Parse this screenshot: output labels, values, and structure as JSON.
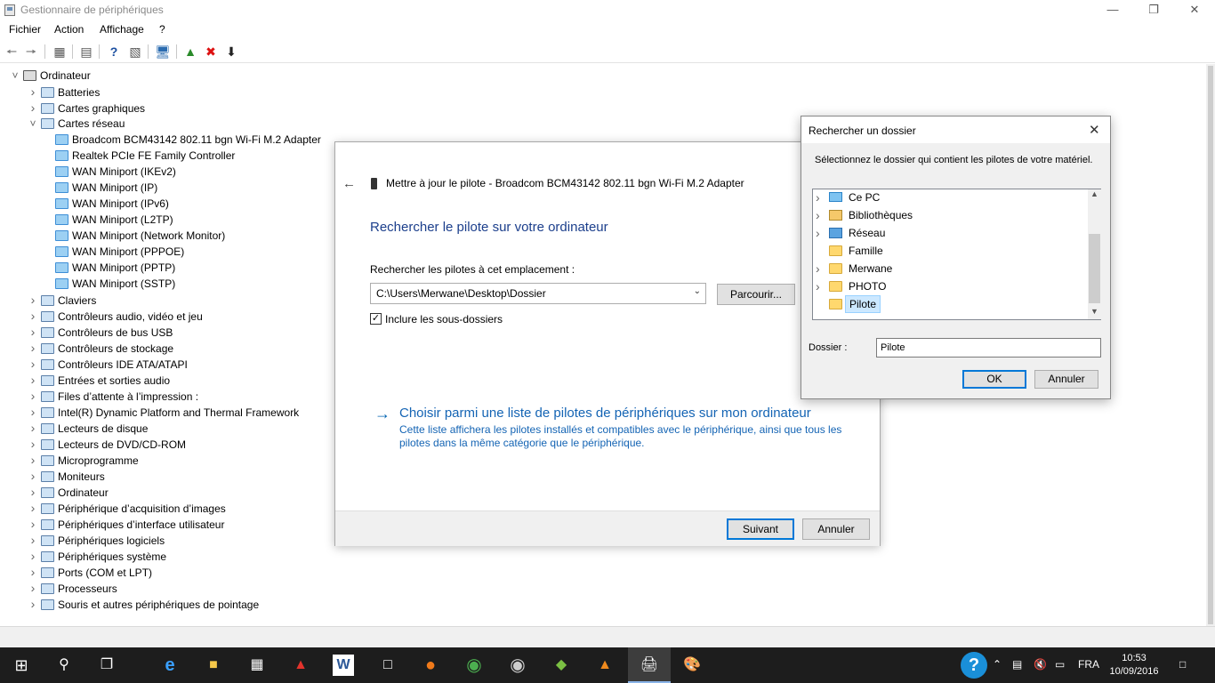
{
  "window": {
    "title": "Gestionnaire de périphériques"
  },
  "menu": [
    "Fichier",
    "Action",
    "Affichage",
    "?"
  ],
  "tree": [
    {
      "label": "Ordinateur",
      "level": 0,
      "expanded": true,
      "icon": "computer-icon"
    },
    {
      "label": "Batteries",
      "level": 1,
      "icon": "battery-icon"
    },
    {
      "label": "Cartes graphiques",
      "level": 1,
      "icon": "display-adapter-icon"
    },
    {
      "label": "Cartes réseau",
      "level": 1,
      "expanded": true,
      "icon": "network-adapter-icon"
    },
    {
      "label": "Broadcom BCM43142 802.11 bgn Wi-Fi M.2 Adapter",
      "level": 2,
      "icon": "network-adapter-icon"
    },
    {
      "label": "Realtek PCIe FE Family Controller",
      "level": 2,
      "icon": "network-adapter-icon"
    },
    {
      "label": "WAN Miniport (IKEv2)",
      "level": 2,
      "icon": "network-adapter-icon"
    },
    {
      "label": "WAN Miniport (IP)",
      "level": 2,
      "icon": "network-adapter-icon"
    },
    {
      "label": "WAN Miniport (IPv6)",
      "level": 2,
      "icon": "network-adapter-icon"
    },
    {
      "label": "WAN Miniport (L2TP)",
      "level": 2,
      "icon": "network-adapter-icon"
    },
    {
      "label": "WAN Miniport (Network Monitor)",
      "level": 2,
      "icon": "network-adapter-icon"
    },
    {
      "label": "WAN Miniport (PPPOE)",
      "level": 2,
      "icon": "network-adapter-icon"
    },
    {
      "label": "WAN Miniport (PPTP)",
      "level": 2,
      "icon": "network-adapter-icon"
    },
    {
      "label": "WAN Miniport (SSTP)",
      "level": 2,
      "icon": "network-adapter-icon"
    },
    {
      "label": "Claviers",
      "level": 1,
      "icon": "keyboard-icon"
    },
    {
      "label": "Contrôleurs audio, vidéo et jeu",
      "level": 1,
      "icon": "audio-icon"
    },
    {
      "label": "Contrôleurs de bus USB",
      "level": 1,
      "icon": "usb-icon"
    },
    {
      "label": "Contrôleurs de stockage",
      "level": 1,
      "icon": "storage-icon"
    },
    {
      "label": "Contrôleurs IDE ATA/ATAPI",
      "level": 1,
      "icon": "ide-icon"
    },
    {
      "label": "Entrées et sorties audio",
      "level": 1,
      "icon": "speaker-icon"
    },
    {
      "label": "Files d’attente à l’impression :",
      "level": 1,
      "icon": "printer-icon"
    },
    {
      "label": "Intel(R) Dynamic Platform and Thermal Framework",
      "level": 1,
      "icon": "chip-icon"
    },
    {
      "label": "Lecteurs de disque",
      "level": 1,
      "icon": "disk-icon"
    },
    {
      "label": "Lecteurs de DVD/CD-ROM",
      "level": 1,
      "icon": "dvd-icon"
    },
    {
      "label": "Microprogramme",
      "level": 1,
      "icon": "firmware-icon"
    },
    {
      "label": "Moniteurs",
      "level": 1,
      "icon": "monitor-icon"
    },
    {
      "label": "Ordinateur",
      "level": 1,
      "icon": "computer-icon"
    },
    {
      "label": "Périphérique d’acquisition d’images",
      "level": 1,
      "icon": "camera-icon"
    },
    {
      "label": "Périphériques d’interface utilisateur",
      "level": 1,
      "icon": "hid-icon"
    },
    {
      "label": "Périphériques logiciels",
      "level": 1,
      "icon": "software-device-icon"
    },
    {
      "label": "Périphériques système",
      "level": 1,
      "icon": "system-device-icon"
    },
    {
      "label": "Ports (COM et LPT)",
      "level": 1,
      "icon": "port-icon"
    },
    {
      "label": "Processeurs",
      "level": 1,
      "icon": "processor-icon"
    },
    {
      "label": "Souris et autres périphériques de pointage",
      "level": 1,
      "icon": "mouse-icon"
    }
  ],
  "wizard": {
    "header": "Mettre à jour le pilote - Broadcom BCM43142 802.11 bgn Wi-Fi M.2 Adapter",
    "heading": "Rechercher le pilote sur votre ordinateur",
    "location_label": "Rechercher les pilotes à cet emplacement :",
    "location_value": "C:\\Users\\Merwane\\Desktop\\Dossier",
    "browse_label": "Parcourir...",
    "include_subfolders_label": "Inclure les sous-dossiers",
    "include_subfolders_checked": true,
    "pick_link": "Choisir parmi une liste de pilotes de périphériques sur mon ordinateur",
    "pick_desc": "Cette liste affichera les pilotes installés et compatibles avec le périphérique, ainsi que tous les pilotes dans la même catégorie que le périphérique.",
    "next_label": "Suivant",
    "cancel_label": "Annuler"
  },
  "folder_dialog": {
    "title": "Rechercher un dossier",
    "instruction": "Sélectionnez le dossier qui contient les pilotes de votre matériel.",
    "items": [
      {
        "label": "Ce PC",
        "icon": "pc-icon",
        "expandable": true
      },
      {
        "label": "Bibliothèques",
        "icon": "library-icon",
        "expandable": true
      },
      {
        "label": "Réseau",
        "icon": "network-icon",
        "expandable": true
      },
      {
        "label": "Famille",
        "icon": "folder-icon",
        "expandable": false
      },
      {
        "label": "Merwane",
        "icon": "folder-icon",
        "expandable": true
      },
      {
        "label": "PHOTO",
        "icon": "folder-icon",
        "expandable": true
      },
      {
        "label": "Pilote",
        "icon": "folder-icon",
        "expandable": false,
        "selected": true
      }
    ],
    "folder_label": "Dossier :",
    "folder_value": "Pilote",
    "ok_label": "OK",
    "cancel_label": "Annuler"
  },
  "taskbar": {
    "language": "FRA",
    "time": "10:53",
    "date": "10/09/2016"
  }
}
